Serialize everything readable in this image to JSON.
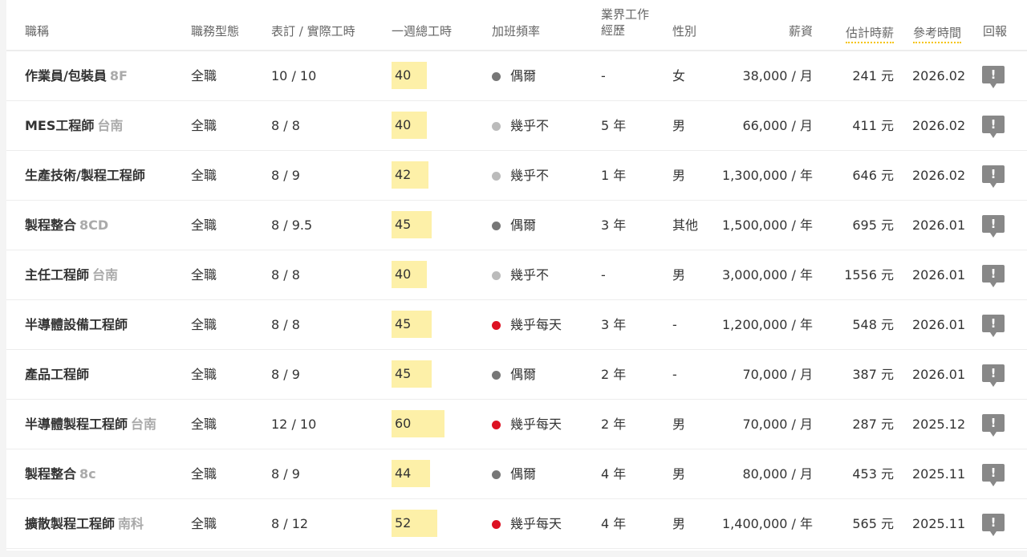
{
  "colors": {
    "dot_sometimes": "#777777",
    "dot_rarely": "#bbbbbb",
    "dot_daily": "#dd1122",
    "hours_bg": "#fdf0a8"
  },
  "header": {
    "title": "職稱",
    "type": "職務型態",
    "contract_actual": "表訂 / 實際工時",
    "weekly": "一週總工時",
    "overtime": "加班頻率",
    "exp_line1": "業界工作",
    "exp_line2": "經歷",
    "gender": "性別",
    "salary": "薪資",
    "hourly": "估計時薪",
    "ref_time": "參考時間",
    "report": "回報"
  },
  "rows": [
    {
      "title": "作業員/包裝員",
      "loc": "8F",
      "type": "全職",
      "hours": "10 / 10",
      "weekly": 40,
      "overtime": "偶爾",
      "overtime_level": "sometimes",
      "exp": "-",
      "gender": "女",
      "salary": "38,000 / 月",
      "hourly": "241 元",
      "date": "2026.02",
      "report_icon": "!"
    },
    {
      "title": "MES工程師",
      "loc": "台南",
      "type": "全職",
      "hours": "8 / 8",
      "weekly": 40,
      "overtime": "幾乎不",
      "overtime_level": "rarely",
      "exp": "5 年",
      "gender": "男",
      "salary": "66,000 / 月",
      "hourly": "411 元",
      "date": "2026.02",
      "report_icon": "!"
    },
    {
      "title": "生產技術/製程工程師",
      "loc": "",
      "type": "全職",
      "hours": "8 / 9",
      "weekly": 42,
      "overtime": "幾乎不",
      "overtime_level": "rarely",
      "exp": "1 年",
      "gender": "男",
      "salary": "1,300,000 / 年",
      "hourly": "646 元",
      "date": "2026.02",
      "report_icon": "!"
    },
    {
      "title": "製程整合",
      "loc": "8CD",
      "type": "全職",
      "hours": "8 / 9.5",
      "weekly": 45,
      "overtime": "偶爾",
      "overtime_level": "sometimes",
      "exp": "3 年",
      "gender": "其他",
      "salary": "1,500,000 / 年",
      "hourly": "695 元",
      "date": "2026.01",
      "report_icon": "!"
    },
    {
      "title": "主任工程師",
      "loc": "台南",
      "type": "全職",
      "hours": "8 / 8",
      "weekly": 40,
      "overtime": "幾乎不",
      "overtime_level": "rarely",
      "exp": "-",
      "gender": "男",
      "salary": "3,000,000 / 年",
      "hourly": "1556 元",
      "date": "2026.01",
      "report_icon": "!"
    },
    {
      "title": "半導體設備工程師",
      "loc": "",
      "type": "全職",
      "hours": "8 / 8",
      "weekly": 45,
      "overtime": "幾乎每天",
      "overtime_level": "daily",
      "exp": "3 年",
      "gender": "-",
      "salary": "1,200,000 / 年",
      "hourly": "548 元",
      "date": "2026.01",
      "report_icon": "!"
    },
    {
      "title": "產品工程師",
      "loc": "",
      "type": "全職",
      "hours": "8 / 9",
      "weekly": 45,
      "overtime": "偶爾",
      "overtime_level": "sometimes",
      "exp": "2 年",
      "gender": "-",
      "salary": "70,000 / 月",
      "hourly": "387 元",
      "date": "2026.01",
      "report_icon": "!"
    },
    {
      "title": "半導體製程工程師",
      "loc": "台南",
      "type": "全職",
      "hours": "12 / 10",
      "weekly": 60,
      "overtime": "幾乎每天",
      "overtime_level": "daily",
      "exp": "2 年",
      "gender": "男",
      "salary": "70,000 / 月",
      "hourly": "287 元",
      "date": "2025.12",
      "report_icon": "!"
    },
    {
      "title": "製程整合",
      "loc": "8c",
      "type": "全職",
      "hours": "8 / 9",
      "weekly": 44,
      "overtime": "偶爾",
      "overtime_level": "sometimes",
      "exp": "4 年",
      "gender": "男",
      "salary": "80,000 / 月",
      "hourly": "453 元",
      "date": "2025.11",
      "report_icon": "!"
    },
    {
      "title": "擴散製程工程師",
      "loc": "南科",
      "type": "全職",
      "hours": "8 / 12",
      "weekly": 52,
      "overtime": "幾乎每天",
      "overtime_level": "daily",
      "exp": "4 年",
      "gender": "男",
      "salary": "1,400,000 / 年",
      "hourly": "565 元",
      "date": "2025.11",
      "report_icon": "!"
    }
  ]
}
